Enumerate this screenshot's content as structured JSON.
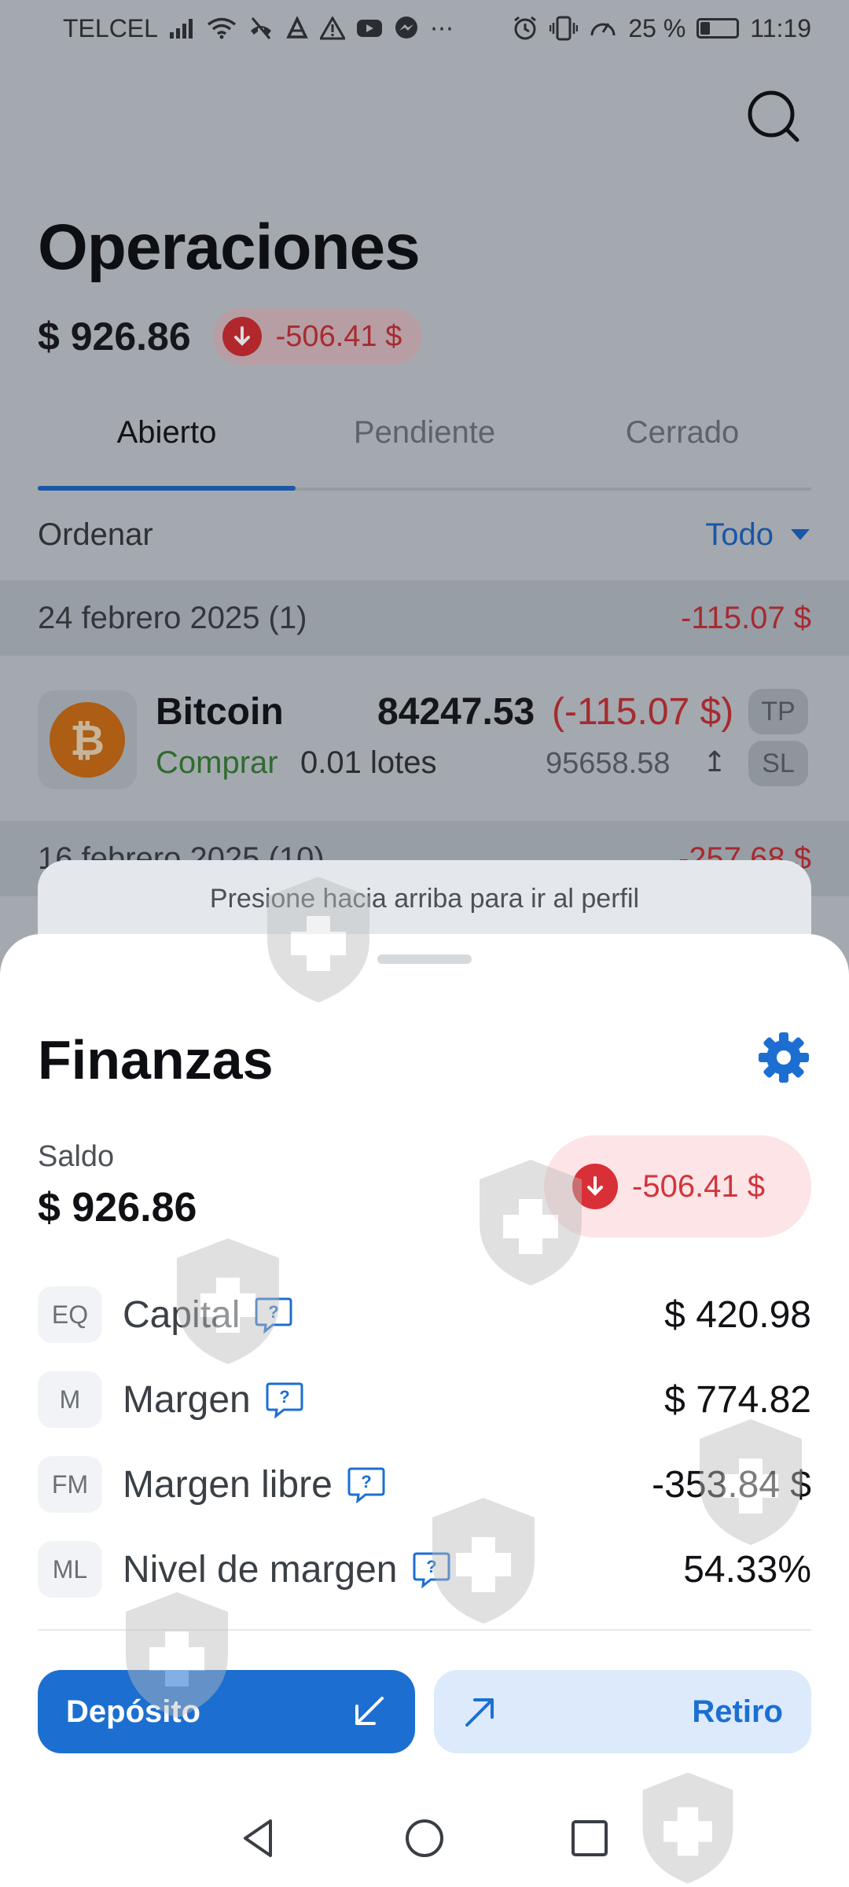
{
  "status_bar": {
    "carrier": "TELCEL",
    "battery": "25 %",
    "time": "11:19",
    "icons_left": [
      "signal-icon",
      "wifi-icon",
      "no-call-icon",
      "app-icon",
      "warning-icon",
      "youtube-icon",
      "messenger-icon",
      "more-icon"
    ],
    "icons_right": [
      "alarm-icon",
      "vibrate-icon",
      "speed-icon",
      "battery-icon"
    ]
  },
  "header": {
    "title": "Operaciones",
    "balance": "$ 926.86",
    "pnl": "-506.41 $"
  },
  "tabs": [
    {
      "label": "Abierto",
      "active": true
    },
    {
      "label": "Pendiente",
      "active": false
    },
    {
      "label": "Cerrado",
      "active": false
    }
  ],
  "sort": {
    "label": "Ordenar",
    "value": "Todo"
  },
  "groups": [
    {
      "date": "24 febrero 2025 (1)",
      "pnl": "-115.07 $"
    },
    {
      "date": "16 febrero 2025 (10)",
      "pnl": "-257.68 $"
    }
  ],
  "trade": {
    "name": "Bitcoin",
    "open_price": "84247.53",
    "pnl": "(-115.07 $)",
    "side": "Comprar",
    "lots": "0.01 lotes",
    "current_price": "95658.58",
    "tp": "TP",
    "sl": "SL"
  },
  "hint": "Presione hacia arriba para ir al perfil",
  "finance": {
    "title": "Finanzas",
    "saldo_label": "Saldo",
    "saldo_value": "$ 926.86",
    "pnl": "-506.41 $",
    "rows": [
      {
        "badge": "EQ",
        "label": "Capital",
        "value": "$ 420.98"
      },
      {
        "badge": "M",
        "label": "Margen",
        "value": "$ 774.82"
      },
      {
        "badge": "FM",
        "label": "Margen libre",
        "value": "-353.84 $"
      },
      {
        "badge": "ML",
        "label": "Nivel de margen",
        "value": "54.33%"
      }
    ],
    "deposit_label": "Depósito",
    "withdraw_label": "Retiro"
  },
  "colors": {
    "accent": "#1c6fd1",
    "negative": "#d0363c",
    "buy": "#2f6b2f"
  }
}
